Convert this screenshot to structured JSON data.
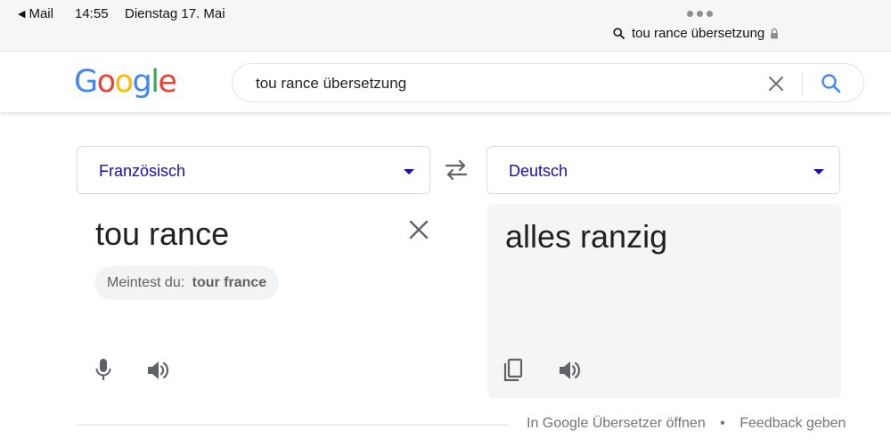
{
  "status_bar": {
    "back_app": "Mail",
    "time": "14:55",
    "date": "Dienstag 17. Mai"
  },
  "safari": {
    "address": "tou rance übersetzung"
  },
  "google": {
    "logo": {
      "G": "G",
      "o1": "o",
      "o2": "o",
      "g": "g",
      "l": "l",
      "e": "e"
    },
    "search_query": "tou rance übersetzung"
  },
  "translator": {
    "source_language": "Französisch",
    "target_language": "Deutsch",
    "source_text": "tou rance",
    "suggestion_prefix": "Meintest du:",
    "suggestion_value": "tour france",
    "translation": "alles ranzig"
  },
  "footer": {
    "open_link": "In Google Übersetzer öffnen",
    "separator": "•",
    "feedback_link": "Feedback geben"
  },
  "colors": {
    "link_blue": "#1a0dab",
    "google_blue": "#4285f4",
    "google_red": "#ea4335",
    "google_yellow": "#fbbc05",
    "google_green": "#34a853",
    "icon_grey": "#5f6368"
  },
  "icons": [
    "back-triangle-icon",
    "more-dots-icon",
    "search-icon",
    "lock-icon",
    "clear-icon",
    "swap-icon",
    "mic-icon",
    "speaker-icon",
    "copy-icon",
    "dropdown-caret-icon"
  ]
}
